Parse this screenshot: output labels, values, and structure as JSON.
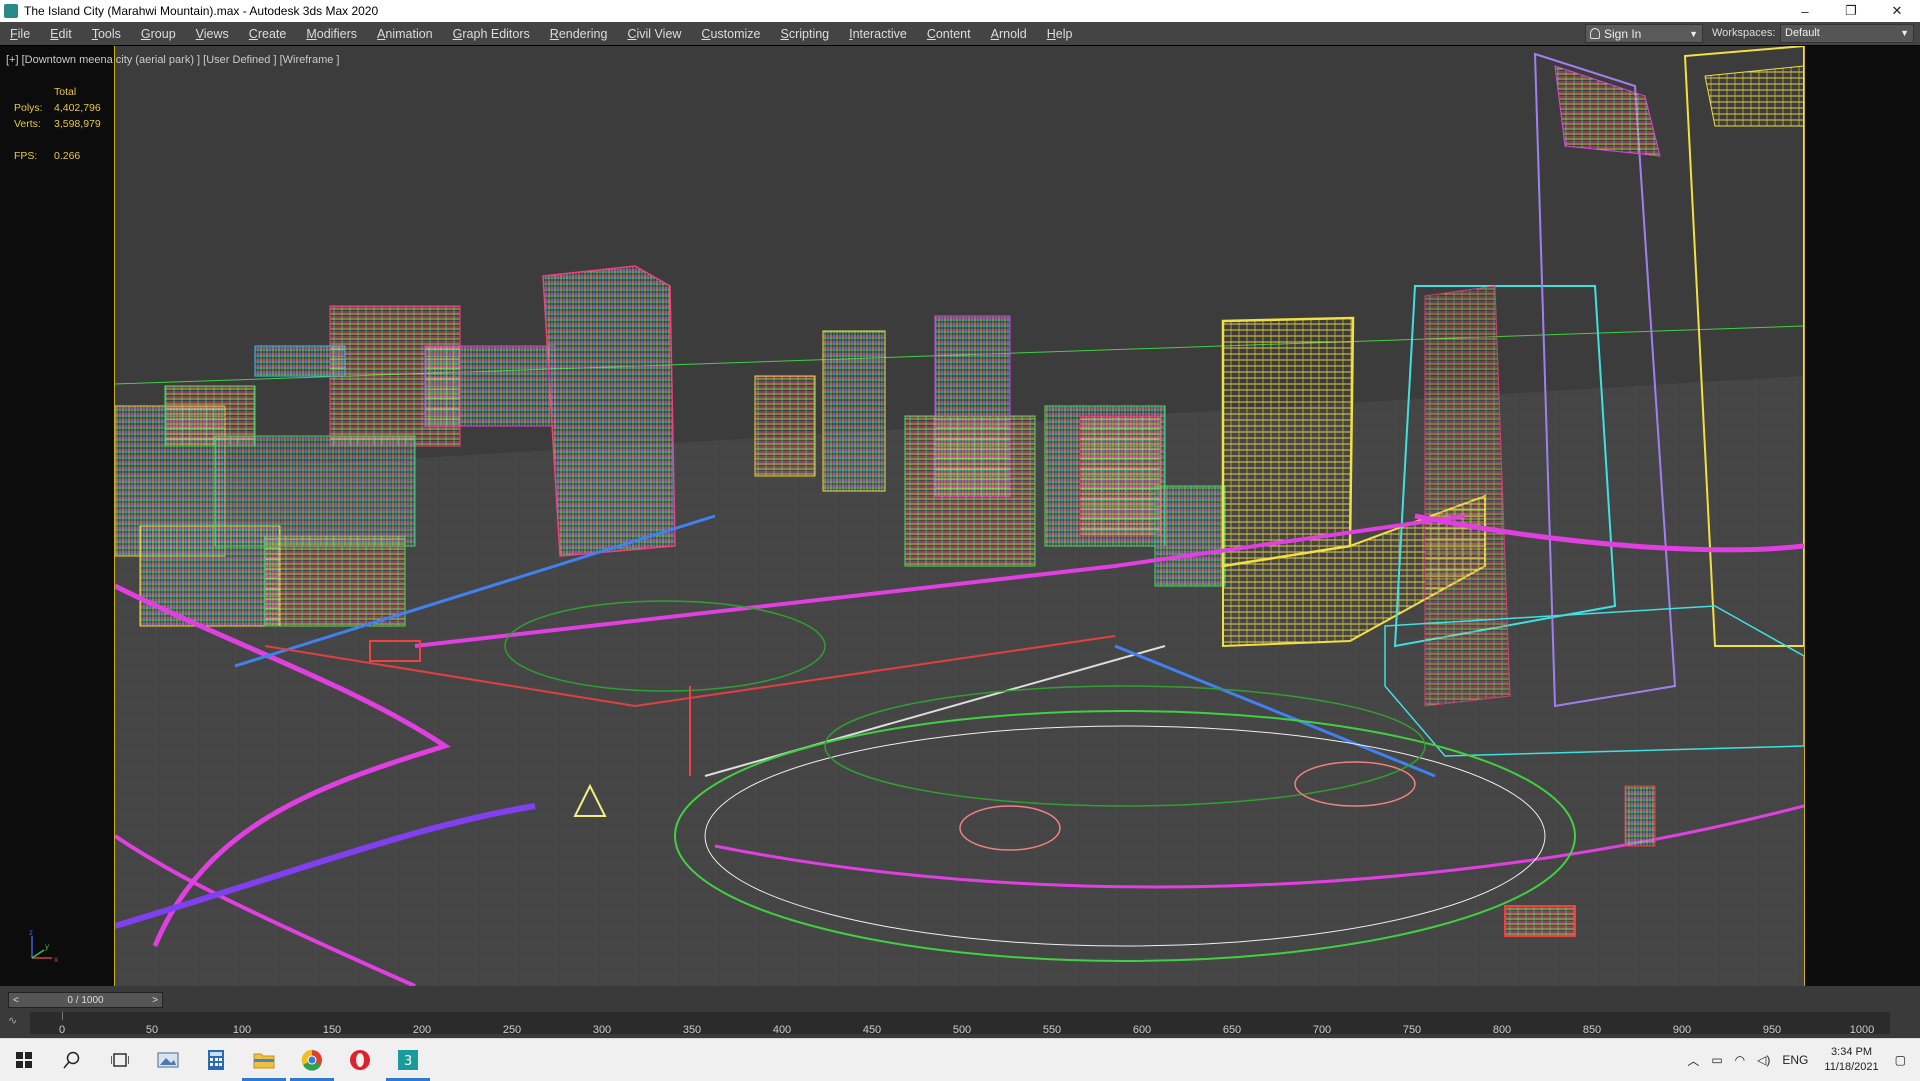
{
  "window": {
    "title": "The Island City (Marahwi Mountain).max - Autodesk 3ds Max 2020",
    "minimize": "–",
    "restore": "❐",
    "close": "✕"
  },
  "menu": [
    "File",
    "Edit",
    "Tools",
    "Group",
    "Views",
    "Create",
    "Modifiers",
    "Animation",
    "Graph Editors",
    "Rendering",
    "Civil View",
    "Customize",
    "Scripting",
    "Interactive",
    "Content",
    "Arnold",
    "Help"
  ],
  "signin": {
    "label": "Sign In"
  },
  "workspaces": {
    "label": "Workspaces:",
    "value": "Default"
  },
  "viewport": {
    "label": "[+] [Downtown meena city (aerial park) ] [User Defined ] [Wireframe ]",
    "stats": {
      "header": "Total",
      "polys_label": "Polys:",
      "polys": "4,402,796",
      "verts_label": "Verts:",
      "verts": "3,598,979",
      "fps_label": "FPS:",
      "fps": "0.266"
    },
    "gizmo": {
      "x": "x",
      "y": "y",
      "z": "z"
    }
  },
  "timeline": {
    "counter": "0 / 1000",
    "prev": "<",
    "next": ">",
    "ticks": [
      "0",
      "50",
      "100",
      "150",
      "200",
      "250",
      "300",
      "350",
      "400",
      "450",
      "500",
      "550",
      "600",
      "650",
      "700",
      "750",
      "800",
      "850",
      "900",
      "950",
      "1000"
    ]
  },
  "taskbar": {
    "clock_time": "3:34 PM",
    "clock_date": "11/18/2021",
    "language": "ENG"
  },
  "colors": {
    "accent_border": "#c8b020",
    "stats_text": "#e8c840",
    "viewport_bg": "#3c3c3c"
  }
}
